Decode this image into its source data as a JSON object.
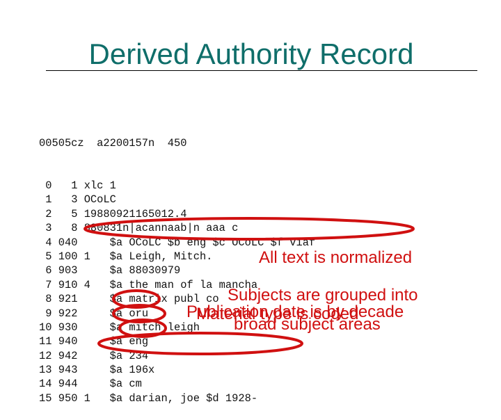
{
  "slide": {
    "title": "Derived Authority Record"
  },
  "record": {
    "leader": "00505cz  a2200157n  450",
    "fields": [
      {
        "idx": " 0",
        "tag": "   1",
        "ind": "",
        "content": "xlc 1"
      },
      {
        "idx": " 1",
        "tag": "   3",
        "ind": "",
        "content": "OCoLC"
      },
      {
        "idx": " 2",
        "tag": "   5",
        "ind": "",
        "content": "19880921165012.4"
      },
      {
        "idx": " 3",
        "tag": "   8",
        "ind": "",
        "content": "880831n|acannaab|n aaa c"
      },
      {
        "idx": " 4",
        "tag": " 040",
        "ind": "  ",
        "content": "$a OCoLC $b eng $c OCoLC $f viaf"
      },
      {
        "idx": " 5",
        "tag": " 100",
        "ind": " 1",
        "content": "$a Leigh, Mitch."
      },
      {
        "idx": " 6",
        "tag": " 903",
        "ind": "  ",
        "content": "$a 88030979"
      },
      {
        "idx": " 7",
        "tag": " 910",
        "ind": " 4",
        "content": "$a the man of la mancha"
      },
      {
        "idx": " 8",
        "tag": " 921",
        "ind": "  ",
        "content": "$a matrix publ co"
      },
      {
        "idx": " 9",
        "tag": " 922",
        "ind": "  ",
        "content": "$a oru"
      },
      {
        "idx": "10",
        "tag": " 930",
        "ind": "  ",
        "content": "$a mitch leigh"
      },
      {
        "idx": "11",
        "tag": " 940",
        "ind": "  ",
        "content": "$a eng"
      },
      {
        "idx": "12",
        "tag": " 942",
        "ind": "  ",
        "content": "$a 234"
      },
      {
        "idx": "13",
        "tag": " 943",
        "ind": "  ",
        "content": "$a 196x"
      },
      {
        "idx": "14",
        "tag": " 944",
        "ind": "  ",
        "content": "$a cm"
      },
      {
        "idx": "15",
        "tag": " 950",
        "ind": " 1",
        "content": "$a darian, joe $d 1928-"
      }
    ]
  },
  "annotations": {
    "normalized": "All text is normalized",
    "subjects_line1": "Subjects are grouped into",
    "subjects_line2": "broad subject areas",
    "pubdate": "Publication date is by decade",
    "material": "Material type is coded",
    "color": "#d01010"
  }
}
